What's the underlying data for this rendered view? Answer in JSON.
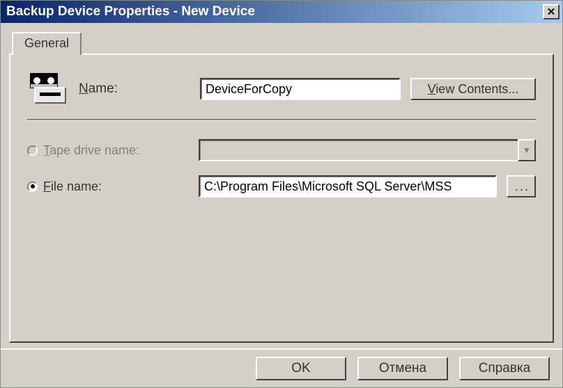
{
  "window": {
    "title": "Backup Device Properties - New Device"
  },
  "tabs": {
    "general": "General"
  },
  "name": {
    "label_pre": "N",
    "label_rest": "ame:",
    "value": "DeviceForCopy"
  },
  "view_contents": {
    "pre": "V",
    "rest": "iew Contents..."
  },
  "tape": {
    "label_pre": "T",
    "label_rest": "ape drive name:",
    "value": ""
  },
  "file": {
    "label_pre": "F",
    "label_rest": "ile name:",
    "value": "C:\\Program Files\\Microsoft SQL Server\\MSS"
  },
  "browse_label": "...",
  "buttons": {
    "ok": "OK",
    "cancel": "Отмена",
    "help": "Справка"
  }
}
